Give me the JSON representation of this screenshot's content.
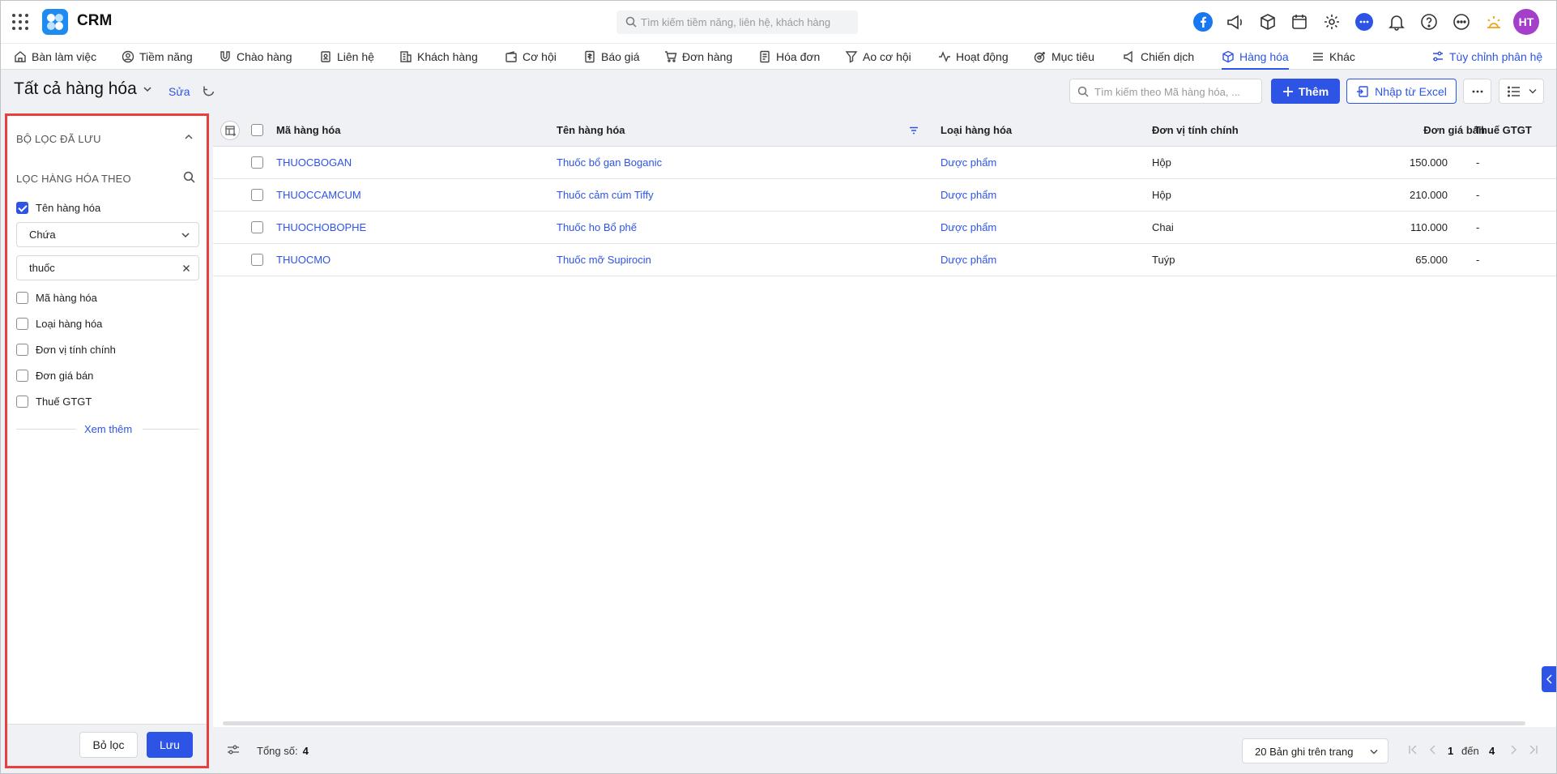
{
  "app": {
    "name": "CRM",
    "avatar_initials": "HT",
    "accent": "#2e54e6",
    "highlight_border": "#e8403f"
  },
  "global_search": {
    "placeholder": "Tìm kiếm tiềm năng, liên hệ, khách hàng"
  },
  "topbar_icons": [
    "facebook-icon",
    "megaphone-icon",
    "box-icon",
    "calendar-icon",
    "gear-icon",
    "chat-icon",
    "bell-icon",
    "help-icon",
    "more-icon",
    "sun-icon"
  ],
  "nav": {
    "items": [
      {
        "label": "Bàn làm việc",
        "icon": "home-icon"
      },
      {
        "label": "Tiềm năng",
        "icon": "user-circle-icon"
      },
      {
        "label": "Chào hàng",
        "icon": "magnet-icon"
      },
      {
        "label": "Liên hệ",
        "icon": "contact-icon"
      },
      {
        "label": "Khách hàng",
        "icon": "building-icon"
      },
      {
        "label": "Cơ hội",
        "icon": "wallet-icon"
      },
      {
        "label": "Báo giá",
        "icon": "quote-icon"
      },
      {
        "label": "Đơn hàng",
        "icon": "cart-icon"
      },
      {
        "label": "Hóa đơn",
        "icon": "invoice-icon"
      },
      {
        "label": "Ao cơ hội",
        "icon": "funnel-icon"
      },
      {
        "label": "Hoạt động",
        "icon": "activity-icon"
      },
      {
        "label": "Mục tiêu",
        "icon": "target-icon"
      },
      {
        "label": "Chiến dịch",
        "icon": "campaign-icon"
      },
      {
        "label": "Hàng hóa",
        "icon": "cube-icon",
        "active": true
      },
      {
        "label": "Khác",
        "icon": "menu-icon"
      }
    ],
    "customize_label": "Tùy chỉnh phân hệ"
  },
  "view": {
    "title": "Tất cả hàng hóa",
    "edit_label": "Sửa",
    "search_placeholder": "Tìm kiếm theo Mã hàng hóa, ...",
    "add_label": "Thêm",
    "import_label": "Nhập từ Excel"
  },
  "filter_panel": {
    "saved_title": "BỘ LỌC ĐÃ LƯU",
    "filter_by_title": "LỌC HÀNG HÓA THEO",
    "fields": [
      {
        "label": "Tên hàng hóa",
        "checked": true
      },
      {
        "label": "Mã hàng hóa",
        "checked": false
      },
      {
        "label": "Loại hàng hóa",
        "checked": false
      },
      {
        "label": "Đơn vị tính chính",
        "checked": false
      },
      {
        "label": "Đơn giá bán",
        "checked": false
      },
      {
        "label": "Thuế GTGT",
        "checked": false
      }
    ],
    "operator": "Chứa",
    "value": "thuốc",
    "show_more_label": "Xem thêm",
    "clear_label": "Bỏ lọc",
    "save_label": "Lưu"
  },
  "table": {
    "columns": [
      "Mã hàng hóa",
      "Tên hàng hóa",
      "Loại hàng hóa",
      "Đơn vị tính chính",
      "Đơn giá bán",
      "Thuế GTGT"
    ],
    "rows": [
      {
        "code": "THUOCBOGAN",
        "name": "Thuốc bổ gan Boganic",
        "type": "Dược phẩm",
        "unit": "Hộp",
        "price": "150.000",
        "vat": "-"
      },
      {
        "code": "THUOCCAMCUM",
        "name": "Thuốc cảm cúm Tiffy",
        "type": "Dược phẩm",
        "unit": "Hộp",
        "price": "210.000",
        "vat": "-"
      },
      {
        "code": "THUOCHOBOPHE",
        "name": "Thuốc ho Bổ phế",
        "type": "Dược phẩm",
        "unit": "Chai",
        "price": "110.000",
        "vat": "-"
      },
      {
        "code": "THUOCMO",
        "name": "Thuốc mỡ Supirocin",
        "type": "Dược phẩm",
        "unit": "Tuýp",
        "price": "65.000",
        "vat": "-"
      }
    ]
  },
  "footer": {
    "total_label": "Tổng số:",
    "total_value": "4",
    "page_size_label": "20 Bản ghi trên trang",
    "range_from": "1",
    "range_sep": "đến",
    "range_to": "4"
  }
}
